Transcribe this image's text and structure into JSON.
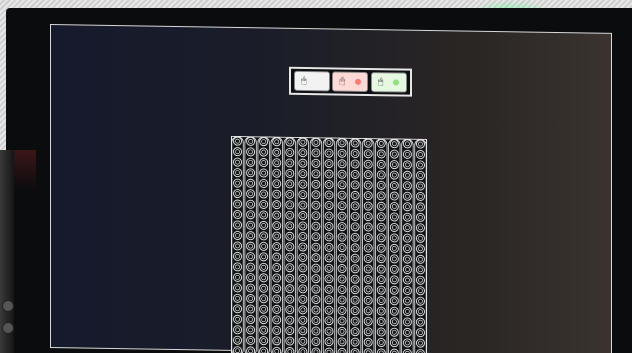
{
  "toolbar": {
    "buttons": [
      {
        "name": "tool-button-white",
        "glyph": "🖱",
        "color": "#f2f2f2",
        "indicator": "#f2f2f2"
      },
      {
        "name": "tool-button-red",
        "glyph": "🖱",
        "color": "#ffd9d6",
        "indicator": "#ff7a70"
      },
      {
        "name": "tool-button-green",
        "glyph": "🖱",
        "color": "#e6f7e2",
        "indicator": "#8fe07e"
      }
    ]
  },
  "grid": {
    "columns": 15,
    "rows": 21,
    "cell_stroke": "#e8e8e8",
    "background": "#121418"
  },
  "colors": {
    "screen_left": "#151a2c",
    "screen_right": "#3a3330",
    "border": "#d9d9d9"
  }
}
